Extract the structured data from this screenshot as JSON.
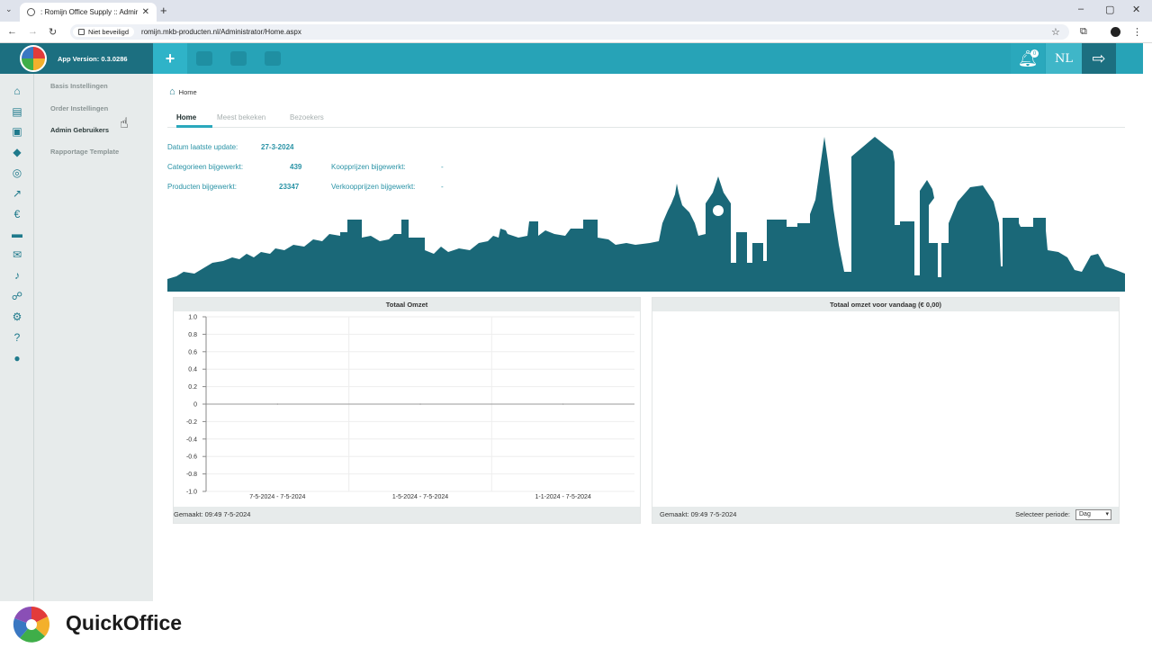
{
  "browser": {
    "tab_title": ": Romijn Office Supply :: Admir",
    "security_label": "Niet beveiligd",
    "url": "romijn.mkb-producten.nl/Administrator/Home.aspx"
  },
  "header": {
    "app_version": "App Version: 0.3.0286",
    "notification_count": "0",
    "language": "NL",
    "icons": [
      "plus-icon",
      "user-icon",
      "user-icon",
      "archive-icon",
      "bell-icon",
      "logout-icon"
    ]
  },
  "sidebar": {
    "icons": [
      "home-icon",
      "archive-icon",
      "contact-icon",
      "tags-icon",
      "coins-icon",
      "chart-icon",
      "euro-icon",
      "truck-icon",
      "envelope-icon",
      "bell-icon",
      "sitemap-icon",
      "cogs-icon",
      "question-icon",
      "globe-icon"
    ],
    "submenu": [
      {
        "label": "Basis Instellingen",
        "active": false
      },
      {
        "label": "Order Instellingen",
        "active": false
      },
      {
        "label": "Admin Gebruikers",
        "active": true
      },
      {
        "label": "Rapportage Template",
        "active": false
      }
    ]
  },
  "main": {
    "breadcrumb": "Home",
    "tabs": [
      {
        "label": "Home",
        "active": true
      },
      {
        "label": "Meest bekeken",
        "active": false
      },
      {
        "label": "Bezoekers",
        "active": false
      }
    ],
    "stats": {
      "last_update_label": "Datum laatste update:",
      "last_update_value": "27-3-2024",
      "categories_label": "Categorieen bijgewerkt:",
      "categories_value": "439",
      "products_label": "Producten bijgewerkt:",
      "products_value": "23347",
      "purchase_label": "Koopprijzen bijgewerkt:",
      "purchase_value": "-",
      "sales_label": "Verkoopprijzen bijgewerkt:",
      "sales_value": "-"
    }
  },
  "panels": {
    "left": {
      "title": "Totaal Omzet",
      "footer": "Gemaakt: 09:49 7-5-2024"
    },
    "right": {
      "title": "Totaal omzet voor vandaag (€ 0,00)",
      "footer": "Gemaakt: 09:49 7-5-2024",
      "period_label": "Selecteer periode:",
      "period_value": "Dag"
    }
  },
  "chart_data": {
    "type": "line",
    "title": "Totaal Omzet",
    "categories": [
      "7-5-2024 - 7-5-2024",
      "1-5-2024 - 7-5-2024",
      "1-1-2024 - 7-5-2024"
    ],
    "series": [
      {
        "values": [
          0,
          0,
          0
        ]
      }
    ],
    "yticks": [
      "1.0",
      "0.8",
      "0.6",
      "0.4",
      "0.2",
      "0",
      "-0.2",
      "-0.4",
      "-0.6",
      "-0.8",
      "-1.0"
    ],
    "ylim": [
      -1.0,
      1.0
    ],
    "grid": true
  },
  "brand": {
    "name": "QuickOffice"
  },
  "colors": {
    "accent": "#27a3b7",
    "dark_accent": "#1c6f80",
    "skyline": "#1a6878"
  }
}
